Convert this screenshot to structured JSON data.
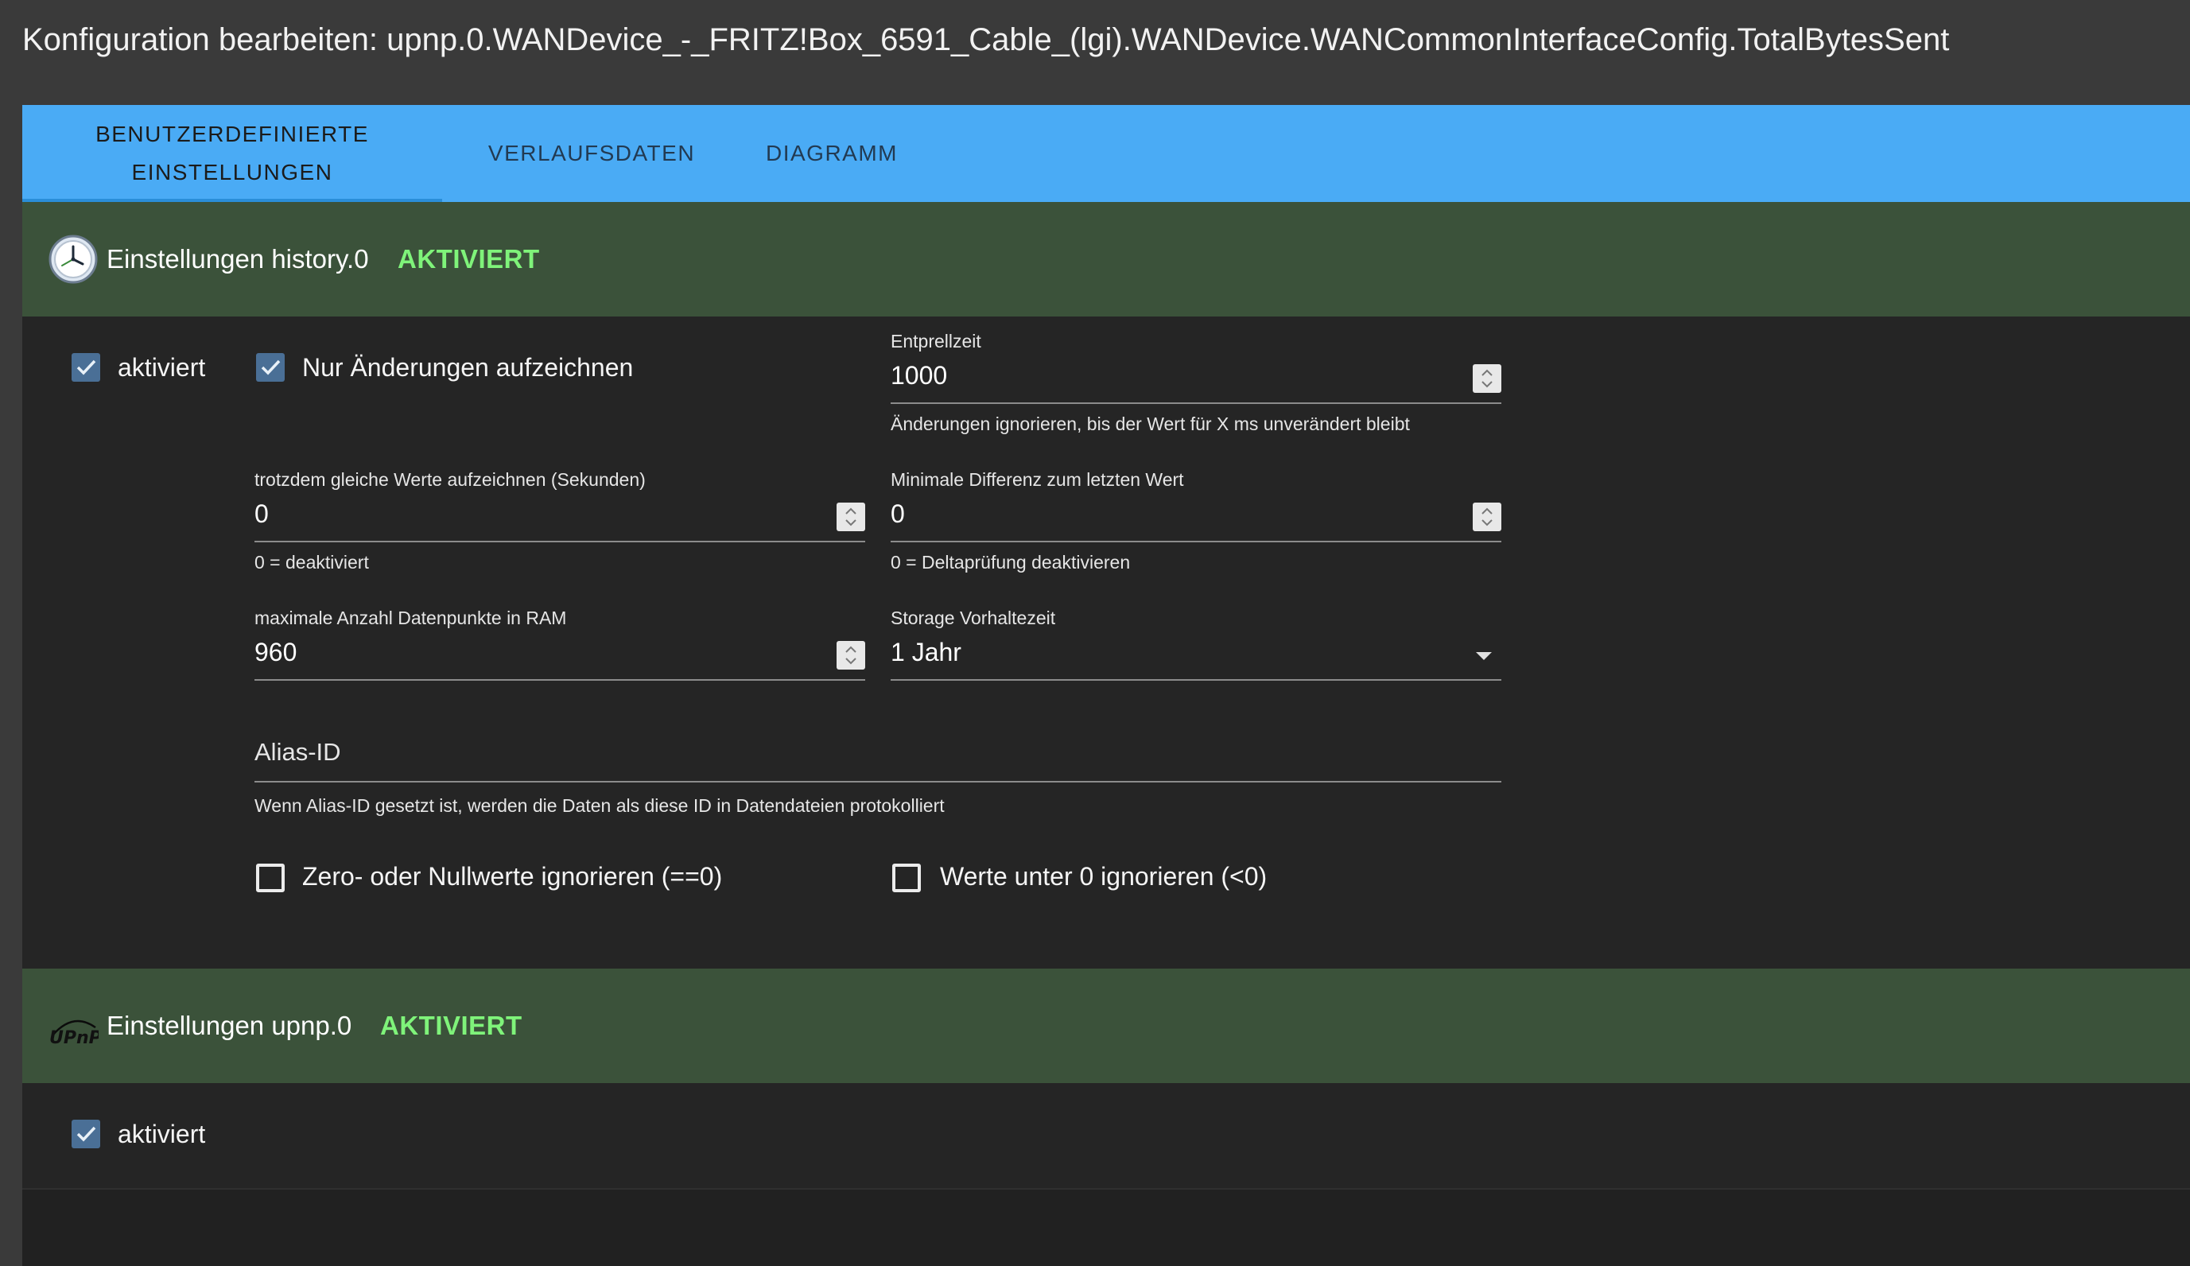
{
  "dialog": {
    "title": "Konfiguration bearbeiten: upnp.0.WANDevice_-_FRITZ!Box_6591_Cable_(lgi).WANDevice.WANCommonInterfaceConfig.TotalBytesSent"
  },
  "tabs": [
    {
      "label_line1": "BENUTZERDEFINIERTE",
      "label_line2": "EINSTELLUNGEN",
      "active": true
    },
    {
      "label": "VERLAUFSDATEN",
      "active": false
    },
    {
      "label": "DIAGRAMM",
      "active": false
    }
  ],
  "history_section": {
    "title": "Einstellungen history.0",
    "status": "AKTIVIERT",
    "icon": "clock-icon",
    "enabled": {
      "label": "aktiviert",
      "checked": true
    },
    "only_changes": {
      "label": "Nur Änderungen aufzeichnen",
      "checked": true
    },
    "debounce": {
      "label": "Entprellzeit",
      "value": "1000",
      "helper": "Änderungen ignorieren, bis der Wert für X ms unverändert bleibt"
    },
    "log_same_values": {
      "label": "trotzdem gleiche Werte aufzeichnen (Sekunden)",
      "value": "0",
      "helper": "0 = deaktiviert"
    },
    "min_difference": {
      "label": "Minimale Differenz zum letzten Wert",
      "value": "0",
      "helper": "0 = Deltaprüfung deaktivieren"
    },
    "max_points_ram": {
      "label": "maximale Anzahl Datenpunkte in RAM",
      "value": "960"
    },
    "retention": {
      "label": "Storage Vorhaltezeit",
      "value": "1 Jahr"
    },
    "alias": {
      "label": "Alias-ID",
      "value": "",
      "helper": "Wenn Alias-ID gesetzt ist, werden die Daten als diese ID in Datendateien protokolliert"
    },
    "ignore_zero": {
      "label": "Zero- oder Nullwerte ignorieren (==0)",
      "checked": false
    },
    "ignore_below_zero": {
      "label": "Werte unter 0 ignorieren (<0)",
      "checked": false
    }
  },
  "upnp_section": {
    "title": "Einstellungen upnp.0",
    "status": "AKTIVIERT",
    "icon": "upnp-logo",
    "logo_text": "UPnP",
    "enabled": {
      "label": "aktiviert",
      "checked": true
    }
  },
  "colors": {
    "tab_bar": "#4aabf5",
    "section_header": "#3b523a",
    "status_green": "#7ff37a",
    "checkbox_checked": "#4a6f96"
  }
}
